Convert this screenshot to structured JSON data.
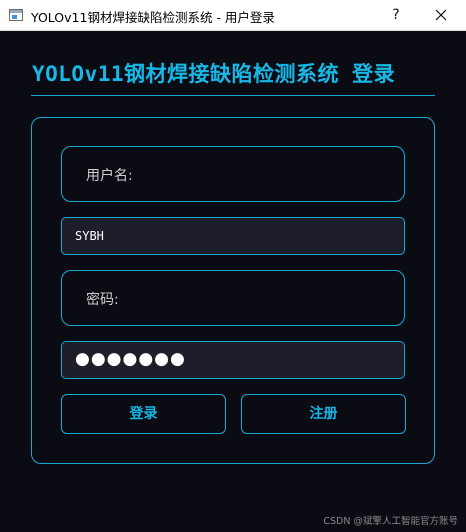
{
  "window": {
    "title": "YOLOv11钢材焊接缺陷检测系统 - 用户登录",
    "help_label": "?"
  },
  "header": {
    "title": "YOLOv11钢材焊接缺陷检测系统 登录"
  },
  "form": {
    "username_label": "用户名:",
    "username_value": "SYBH",
    "password_label": "密码:",
    "password_masked": "●●●●●●●"
  },
  "buttons": {
    "login": "登录",
    "register": "注册"
  },
  "watermark": "CSDN @斌擎人工智能官方账号",
  "colors": {
    "background": "#0b0b14",
    "accent": "#17b8e6",
    "input_bg": "#1e1e2a"
  }
}
